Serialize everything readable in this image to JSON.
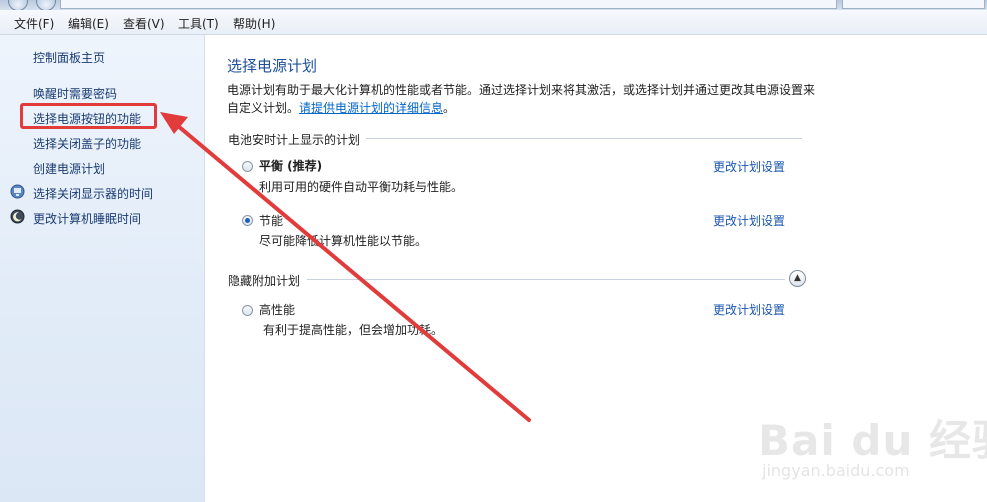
{
  "menu": [
    "文件(F)",
    "编辑(E)",
    "查看(V)",
    "工具(T)",
    "帮助(H)"
  ],
  "sidebar": {
    "home": "控制面板主页",
    "links": [
      "唤醒时需要密码",
      "选择电源按钮的功能",
      "选择关闭盖子的功能",
      "创建电源计划",
      "选择关闭显示器的时间",
      "更改计算机睡眠时间"
    ]
  },
  "main": {
    "title": "选择电源计划",
    "description": "电源计划有助于最大化计算机的性能或者节能。通过选择计划来将其激活，或选择计划并通过更改其电源设置来自定义计划。",
    "description_link": "请提供电源计划的详细信息",
    "description_end": "。",
    "battery_group_label": "电池安时计上显示的计划",
    "plans": [
      {
        "name": "平衡 (推荐)",
        "desc": "利用可用的硬件自动平衡功耗与性能。",
        "selected": false
      },
      {
        "name": "节能",
        "desc": "尽可能降低计算机性能以节能。",
        "selected": true
      }
    ],
    "hidden_group_label": "隐藏附加计划",
    "hidden_plans": [
      {
        "name": "高性能",
        "desc": "有利于提高性能，但会增加功耗。",
        "selected": false
      }
    ],
    "change_link": "更改计划设置"
  },
  "watermark": {
    "main": "Bai du 经验",
    "sub": "jingyan.baidu.com"
  },
  "colors": {
    "highlight": "#e23b3b",
    "link": "#1a56b0",
    "title": "#1e4f9a",
    "sidebar_bg": "#e6eef9"
  }
}
